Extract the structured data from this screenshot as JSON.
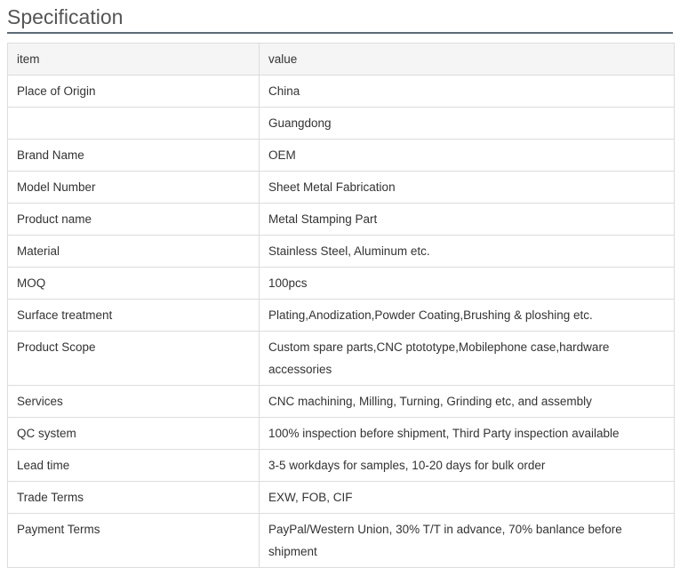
{
  "heading": "Specification",
  "table": {
    "header": {
      "item": "item",
      "value": "value"
    },
    "rows": [
      {
        "item": "Place of Origin",
        "value": "China"
      },
      {
        "item": "",
        "value": "Guangdong"
      },
      {
        "item": "Brand Name",
        "value": "OEM"
      },
      {
        "item": "Model Number",
        "value": "Sheet Metal Fabrication"
      },
      {
        "item": "Product name",
        "value": "Metal Stamping Part"
      },
      {
        "item": "Material",
        "value": "Stainless Steel, Aluminum etc."
      },
      {
        "item": "MOQ",
        "value": "100pcs"
      },
      {
        "item": "Surface treatment",
        "value": "Plating,Anodization,Powder Coating,Brushing & ploshing etc."
      },
      {
        "item": "Product Scope",
        "value": "Custom spare parts,CNC ptototype,Mobilephone case,hardware accessories"
      },
      {
        "item": "Services",
        "value": "CNC machining, Milling, Turning, Grinding etc, and assembly"
      },
      {
        "item": "QC system",
        "value": "100% inspection before shipment, Third Party inspection available"
      },
      {
        "item": "Lead time",
        "value": "3-5 workdays for samples, 10-20 days for bulk order"
      },
      {
        "item": "Trade Terms",
        "value": "EXW, FOB, CIF"
      },
      {
        "item": "Payment Terms",
        "value": "PayPal/Western Union, 30% T/T in advance, 70% banlance before shipment"
      }
    ]
  }
}
